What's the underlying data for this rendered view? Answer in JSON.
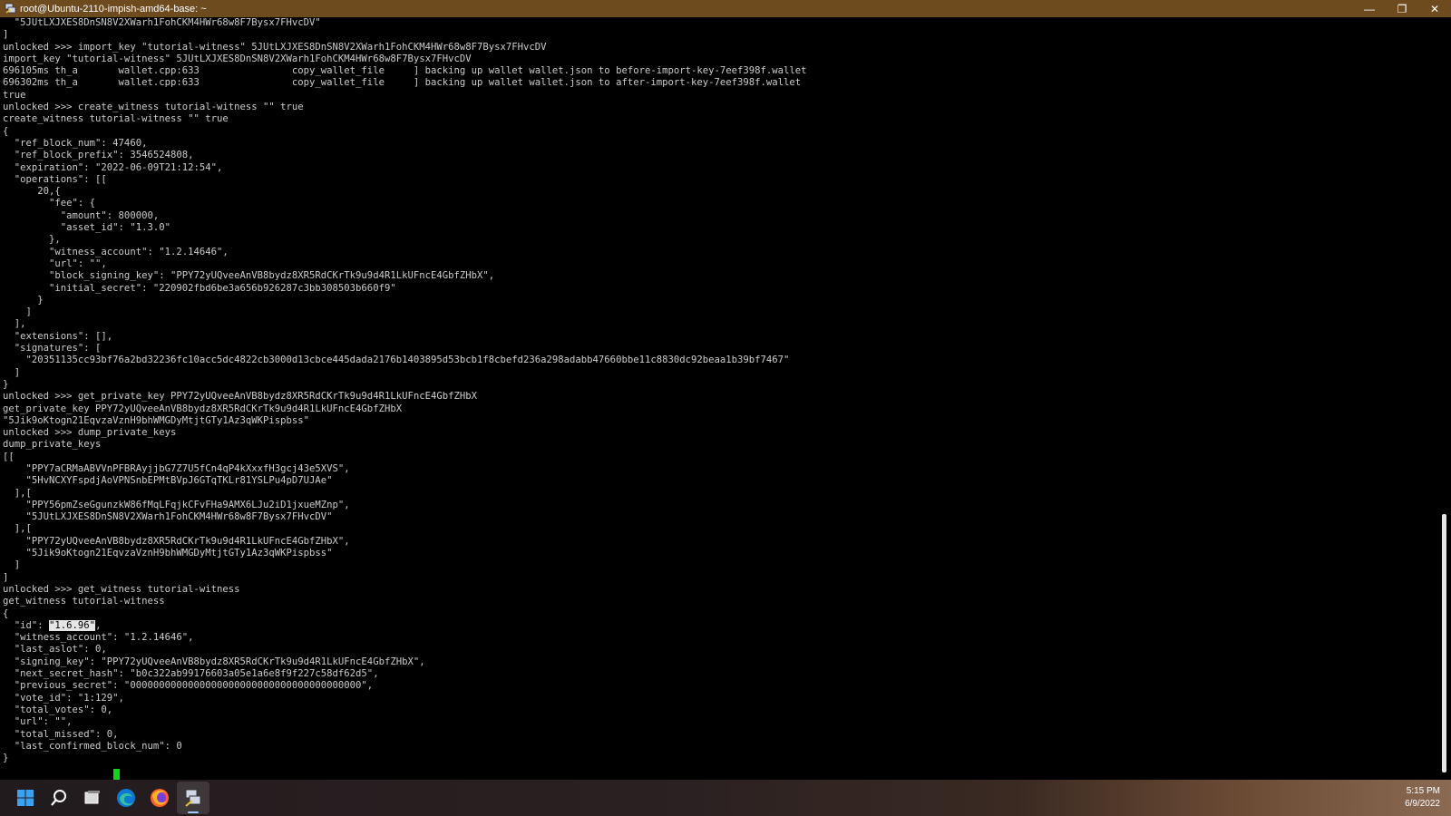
{
  "window": {
    "title": "root@Ubuntu-2110-impish-amd64-base: ~",
    "icon": "putty-terminal-icon",
    "controls": {
      "minimize": "—",
      "maximize": "❐",
      "close": "✕"
    }
  },
  "terminal": {
    "lines": [
      "  \"5JUtLXJXES8DnSN8V2XWarh1FohCKM4HWr68w8F7Bysx7FHvcDV\"",
      "]",
      "unlocked >>> import_key \"tutorial-witness\" 5JUtLXJXES8DnSN8V2XWarh1FohCKM4HWr68w8F7Bysx7FHvcDV",
      "import_key \"tutorial-witness\" 5JUtLXJXES8DnSN8V2XWarh1FohCKM4HWr68w8F7Bysx7FHvcDV",
      "696105ms th_a       wallet.cpp:633                copy_wallet_file     ] backing up wallet wallet.json to before-import-key-7eef398f.wallet",
      "696302ms th_a       wallet.cpp:633                copy_wallet_file     ] backing up wallet wallet.json to after-import-key-7eef398f.wallet",
      "true",
      "unlocked >>> create_witness tutorial-witness \"\" true",
      "create_witness tutorial-witness \"\" true",
      "{",
      "  \"ref_block_num\": 47460,",
      "  \"ref_block_prefix\": 3546524808,",
      "  \"expiration\": \"2022-06-09T21:12:54\",",
      "  \"operations\": [[",
      "      20,{",
      "        \"fee\": {",
      "          \"amount\": 800000,",
      "          \"asset_id\": \"1.3.0\"",
      "        },",
      "        \"witness_account\": \"1.2.14646\",",
      "        \"url\": \"\",",
      "        \"block_signing_key\": \"PPY72yUQveeAnVB8bydz8XR5RdCKrTk9u9d4R1LkUFncE4GbfZHbX\",",
      "        \"initial_secret\": \"220902fbd6be3a656b926287c3bb308503b660f9\"",
      "      }",
      "    ]",
      "  ],",
      "  \"extensions\": [],",
      "  \"signatures\": [",
      "    \"20351135cc93bf76a2bd32236fc10acc5dc4822cb3000d13cbce445dada2176b1403895d53bcb1f8cbefd236a298adabb47660bbe11c8830dc92beaa1b39bf7467\"",
      "  ]",
      "}",
      "unlocked >>> get_private_key PPY72yUQveeAnVB8bydz8XR5RdCKrTk9u9d4R1LkUFncE4GbfZHbX",
      "get_private_key PPY72yUQveeAnVB8bydz8XR5RdCKrTk9u9d4R1LkUFncE4GbfZHbX",
      "\"5Jik9oKtogn21EqvzaVznH9bhWMGDyMtjtGTy1Az3qWKPispbss\"",
      "unlocked >>> dump_private_keys",
      "dump_private_keys",
      "[[",
      "    \"PPY7aCRMaABVVnPFBRAyjjbG7Z7U5fCn4qP4kXxxfH3gcj43e5XVS\",",
      "    \"5HvNCXYFspdjAoVPNSnbEPMtBVpJ6GTqTKLr81YSLPu4pD7UJAe\"",
      "  ],[",
      "    \"PPY56pmZseGgunzkW86fMqLFqjkCFvFHa9AMX6LJu2iD1jxueMZnp\",",
      "    \"5JUtLXJXES8DnSN8V2XWarh1FohCKM4HWr68w8F7Bysx7FHvcDV\"",
      "  ],[",
      "    \"PPY72yUQveeAnVB8bydz8XR5RdCKrTk9u9d4R1LkUFncE4GbfZHbX\",",
      "    \"5Jik9oKtogn21EqvzaVznH9bhWMGDyMtjtGTy1Az3qWKPispbss\"",
      "  ]",
      "]",
      "unlocked >>> get_witness tutorial-witness",
      "get_witness tutorial-witness",
      "{",
      {
        "pre": "  \"id\": ",
        "sel": "\"1.6.96\"",
        "post": ","
      },
      "  \"witness_account\": \"1.2.14646\",",
      "  \"last_aslot\": 0,",
      "  \"signing_key\": \"PPY72yUQveeAnVB8bydz8XR5RdCKrTk9u9d4R1LkUFncE4GbfZHbX\",",
      "  \"next_secret_hash\": \"b0c322ab99176603a05e1a6e8f9f227c58df62d5\",",
      "  \"previous_secret\": \"0000000000000000000000000000000000000000\",",
      "  \"vote_id\": \"1:129\",",
      "  \"total_votes\": 0,",
      "  \"url\": \"\",",
      "  \"total_missed\": 0,",
      "  \"last_confirmed_block_num\": 0",
      "}"
    ],
    "prompt": "unlocked >>> ",
    "colors": {
      "background": "#000000",
      "text": "#cccccc",
      "cursor": "#13d21f"
    }
  },
  "taskbar": {
    "items": [
      {
        "name": "windows-start-icon",
        "active": false
      },
      {
        "name": "search-icon",
        "active": false
      },
      {
        "name": "task-view-icon",
        "active": false
      },
      {
        "name": "edge-browser-icon",
        "active": false
      },
      {
        "name": "firefox-icon",
        "active": false
      },
      {
        "name": "putty-icon",
        "active": true
      }
    ],
    "time": "5:15 PM",
    "date": "6/9/2022"
  }
}
